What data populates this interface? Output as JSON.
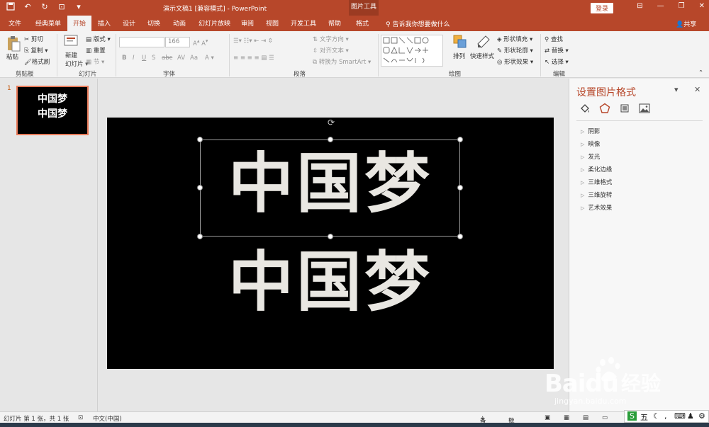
{
  "app": {
    "doc_title": "演示文稿1 [兼容模式] - PowerPoint",
    "context_tab": "图片工具",
    "login": "登录",
    "share": "共享",
    "tell_me": "告诉我你想要做什么"
  },
  "tabs": [
    "文件",
    "经典菜单",
    "开始",
    "插入",
    "设计",
    "切换",
    "动画",
    "幻灯片放映",
    "审阅",
    "视图",
    "开发工具",
    "帮助",
    "格式"
  ],
  "active_tab": "开始",
  "ribbon": {
    "clipboard": {
      "label": "剪贴板",
      "paste": "粘贴",
      "cut": "剪切",
      "copy": "复制",
      "format_painter": "格式刷"
    },
    "slides": {
      "label": "幻灯片",
      "new_slide": "新建\n幻灯片",
      "layout": "版式",
      "reset": "重置",
      "section": "节"
    },
    "font": {
      "label": "字体",
      "font_name": "",
      "font_size": "166"
    },
    "paragraph": {
      "label": "段落",
      "text_direction": "文字方向",
      "align_text": "对齐文本",
      "smartart": "转换为 SmartArt"
    },
    "drawing": {
      "label": "绘图",
      "arrange": "排列",
      "quick_styles": "快速样式",
      "shape_fill": "形状填充",
      "shape_outline": "形状轮廓",
      "shape_effects": "形状效果"
    },
    "editing": {
      "label": "编辑",
      "find": "查找",
      "replace": "替换",
      "select": "选择"
    }
  },
  "thumbnails": [
    {
      "number": "1",
      "lines": [
        "中国梦",
        "中国梦"
      ]
    }
  ],
  "slide": {
    "line1": "中国梦",
    "line2": "中国梦"
  },
  "format_pane": {
    "title": "设置图片格式",
    "sections": [
      "阴影",
      "映像",
      "发光",
      "柔化边缘",
      "三维格式",
      "三维旋转",
      "艺术效果"
    ]
  },
  "status": {
    "slide_info": "幻灯片 第 1 张，共 1 张",
    "language": "中文(中国)",
    "notes": "备注",
    "comments": "批注"
  },
  "watermark": {
    "brand": "Baidu",
    "cn": "经验",
    "url": "jingyan.baidu.com"
  },
  "ime": {
    "label": "五"
  },
  "colors": {
    "accent": "#b7472a",
    "slide_bg": "#000000",
    "slide_text": "#e9e7e2"
  }
}
